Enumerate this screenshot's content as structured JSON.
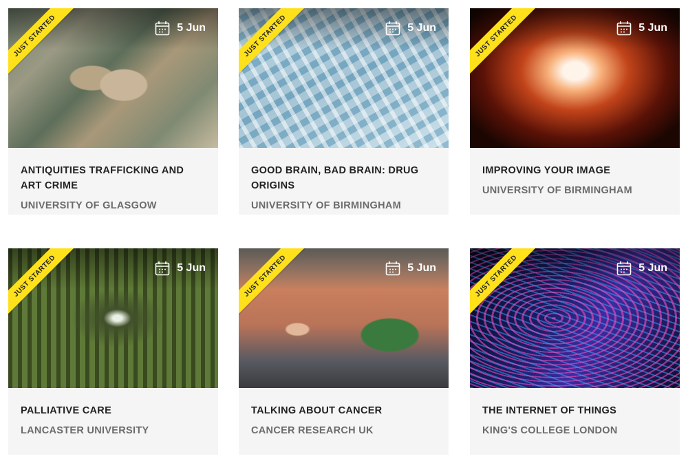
{
  "colors": {
    "ribbon": "#ffe11b",
    "card_background": "#f5f5f5",
    "title_text": "#222222",
    "org_text": "#6b6b6b"
  },
  "icons": {
    "date": "calendar-icon"
  },
  "courses": [
    {
      "badge": "JUST STARTED",
      "date": "5 Jun",
      "title": "ANTIQUITIES TRAFFICKING AND ART CRIME",
      "org": "UNIVERSITY OF GLASGOW"
    },
    {
      "badge": "JUST STARTED",
      "date": "5 Jun",
      "title": "GOOD BRAIN, BAD BRAIN: DRUG ORIGINS",
      "org": "UNIVERSITY OF BIRMINGHAM"
    },
    {
      "badge": "JUST STARTED",
      "date": "5 Jun",
      "title": "IMPROVING YOUR IMAGE",
      "org": "UNIVERSITY OF BIRMINGHAM"
    },
    {
      "badge": "JUST STARTED",
      "date": "5 Jun",
      "title": "PALLIATIVE CARE",
      "org": "LANCASTER UNIVERSITY"
    },
    {
      "badge": "JUST STARTED",
      "date": "5 Jun",
      "title": "TALKING ABOUT CANCER",
      "org": "CANCER RESEARCH UK"
    },
    {
      "badge": "JUST STARTED",
      "date": "5 Jun",
      "title": "THE INTERNET OF THINGS",
      "org": "KING'S COLLEGE LONDON"
    }
  ]
}
